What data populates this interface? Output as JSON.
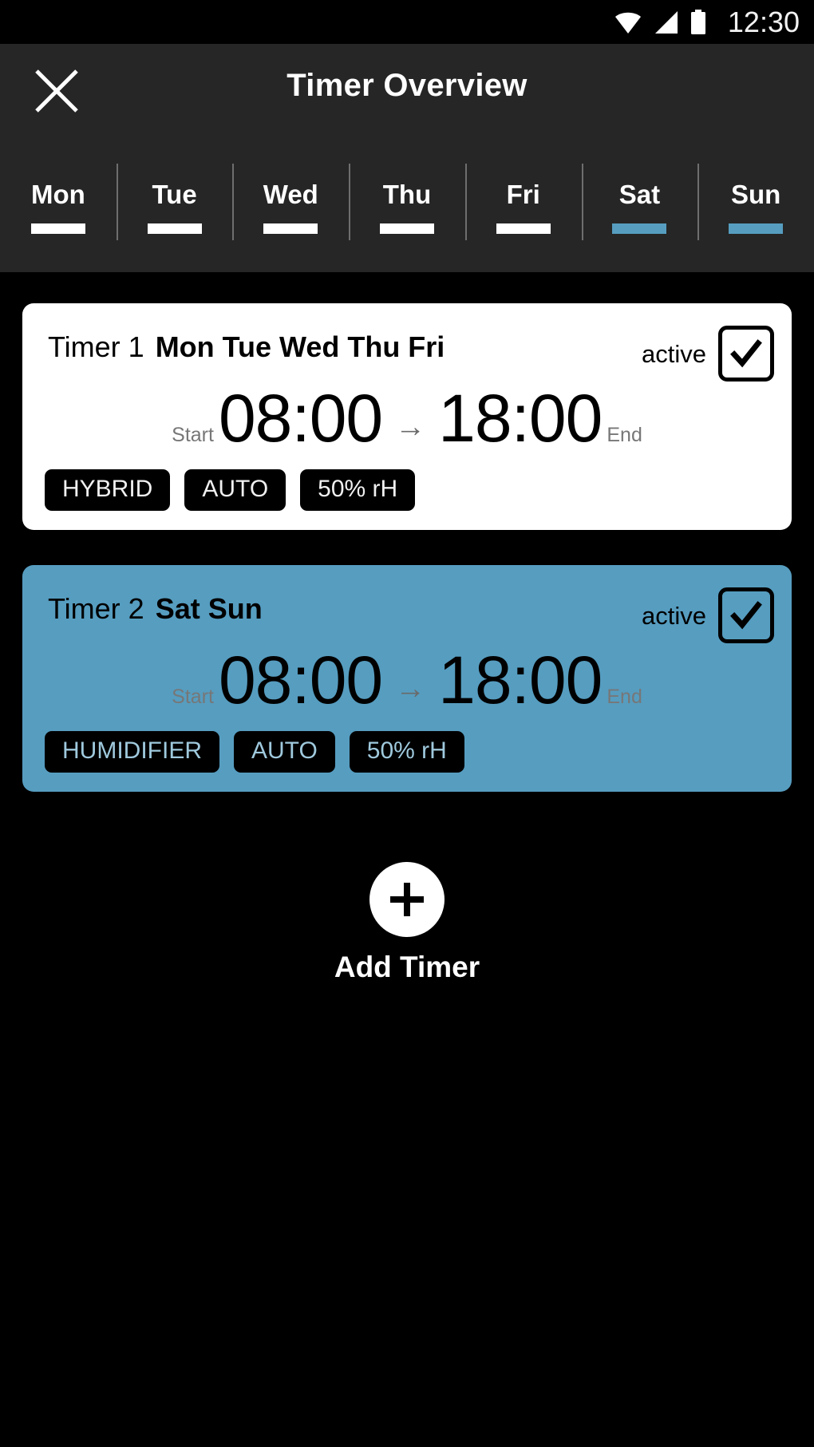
{
  "status_bar": {
    "time": "12:30",
    "icons": [
      "wifi-icon",
      "cell-signal-icon",
      "battery-icon"
    ]
  },
  "app_bar": {
    "title": "Timer Overview",
    "close_icon": "close-icon"
  },
  "day_tabs": [
    {
      "label": "Mon",
      "selected": false
    },
    {
      "label": "Tue",
      "selected": false
    },
    {
      "label": "Wed",
      "selected": false
    },
    {
      "label": "Thu",
      "selected": false
    },
    {
      "label": "Fri",
      "selected": false
    },
    {
      "label": "Sat",
      "selected": true
    },
    {
      "label": "Sun",
      "selected": true
    }
  ],
  "colors": {
    "accent": "#569dc0",
    "background": "#000000",
    "bar": "#262626",
    "card": "#ffffff",
    "chip_bg": "#000000"
  },
  "timers": [
    {
      "name": "Timer 1",
      "days": "Mon Tue Wed Thu Fri",
      "active_label": "active",
      "active": true,
      "start_label": "Start",
      "start_time": "08:00",
      "arrow": "→",
      "end_time": "18:00",
      "end_label": "End",
      "chips": [
        "HYBRID",
        "AUTO",
        "50% rH"
      ]
    },
    {
      "name": "Timer 2",
      "days": "Sat Sun",
      "active_label": "active",
      "active": true,
      "start_label": "Start",
      "start_time": "08:00",
      "arrow": "→",
      "end_time": "18:00",
      "end_label": "End",
      "chips": [
        "HUMIDIFIER",
        "AUTO",
        "50% rH"
      ]
    }
  ],
  "add_timer": {
    "label": "Add Timer",
    "icon": "plus-icon"
  }
}
